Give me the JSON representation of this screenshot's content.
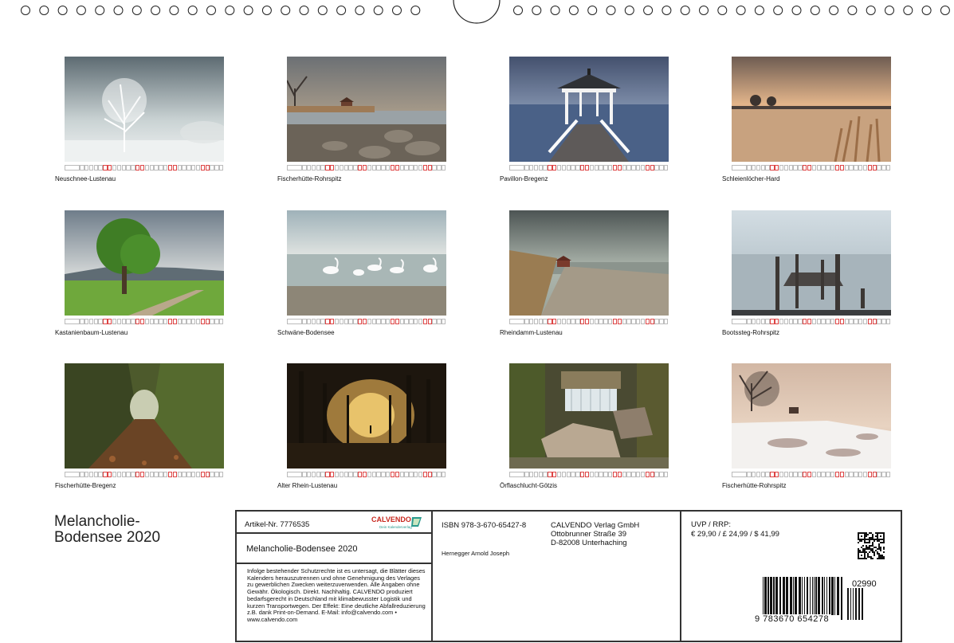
{
  "calendar": {
    "months": [
      {
        "caption": "Neuschnee-Lustenau",
        "scene": "winter-tree"
      },
      {
        "caption": "Fischerhütte-Rohrspitz",
        "scene": "shore-hut"
      },
      {
        "caption": "Pavillon-Bregenz",
        "scene": "pavilion"
      },
      {
        "caption": "Schleienlöcher-Hard",
        "scene": "sunset-reeds"
      },
      {
        "caption": "Kastanienbaum-Lustenau",
        "scene": "chestnut-tree"
      },
      {
        "caption": "Schwäne-Bodensee",
        "scene": "swans"
      },
      {
        "caption": "Rheindamm-Lustenau",
        "scene": "dam-hut"
      },
      {
        "caption": "Bootssteg-Rohrspitz",
        "scene": "jetty"
      },
      {
        "caption": "Fischerhütte-Bregenz",
        "scene": "forest-path"
      },
      {
        "caption": "Alter Rhein-Lustenau",
        "scene": "foggy-forest"
      },
      {
        "caption": "Örflaschlucht-Götzis",
        "scene": "waterfall"
      },
      {
        "caption": "Fischerhütte-Rohrspitz",
        "scene": "snow-shore"
      }
    ]
  },
  "product": {
    "title_line1": "Melancholie-",
    "title_line2": "Bodensee 2020",
    "article_label": "Artikel-Nr. 7776535",
    "brand": "CALVENDO",
    "brand_tagline": "Dein Kalenderverlag",
    "full_title": "Melancholie-Bodensee 2020",
    "legal_text": "Infolge bestehender Schutzrechte ist es untersagt, die Blätter dieses Kalenders herauszutrennen und ohne Genehmigung des Verlages zu gewerblichen Zwecken weiterzuverwenden. Alle Angaben ohne Gewähr. Ökologisch. Direkt. Nachhaltig. CALVENDO produziert bedarfsgerecht in Deutschland mit klimabewusster Logistik und kurzen Transportwegen. Der Effekt: Eine deutliche Abfallreduzierung z.B. dank Print-on-Demand. E-Mail: info@calvendo.com • www.calvendo.com",
    "isbn": "ISBN 978-3-670-65427-8",
    "author": "Hernegger Arnold Joseph",
    "publisher_name": "CALVENDO Verlag GmbH",
    "publisher_street": "Ottobrunner Straße 39",
    "publisher_city": "D-82008 Unterhaching",
    "price_label": "UVP / RRP:",
    "price_values": "€ 29,90 / £ 24,99 / $ 41,99",
    "barcode_digits": "9 783670 654278",
    "addon_digits": "02990"
  },
  "colors": {
    "border": "#333333",
    "brand_red": "#c8281e",
    "brand_teal": "#2a9a8e"
  }
}
